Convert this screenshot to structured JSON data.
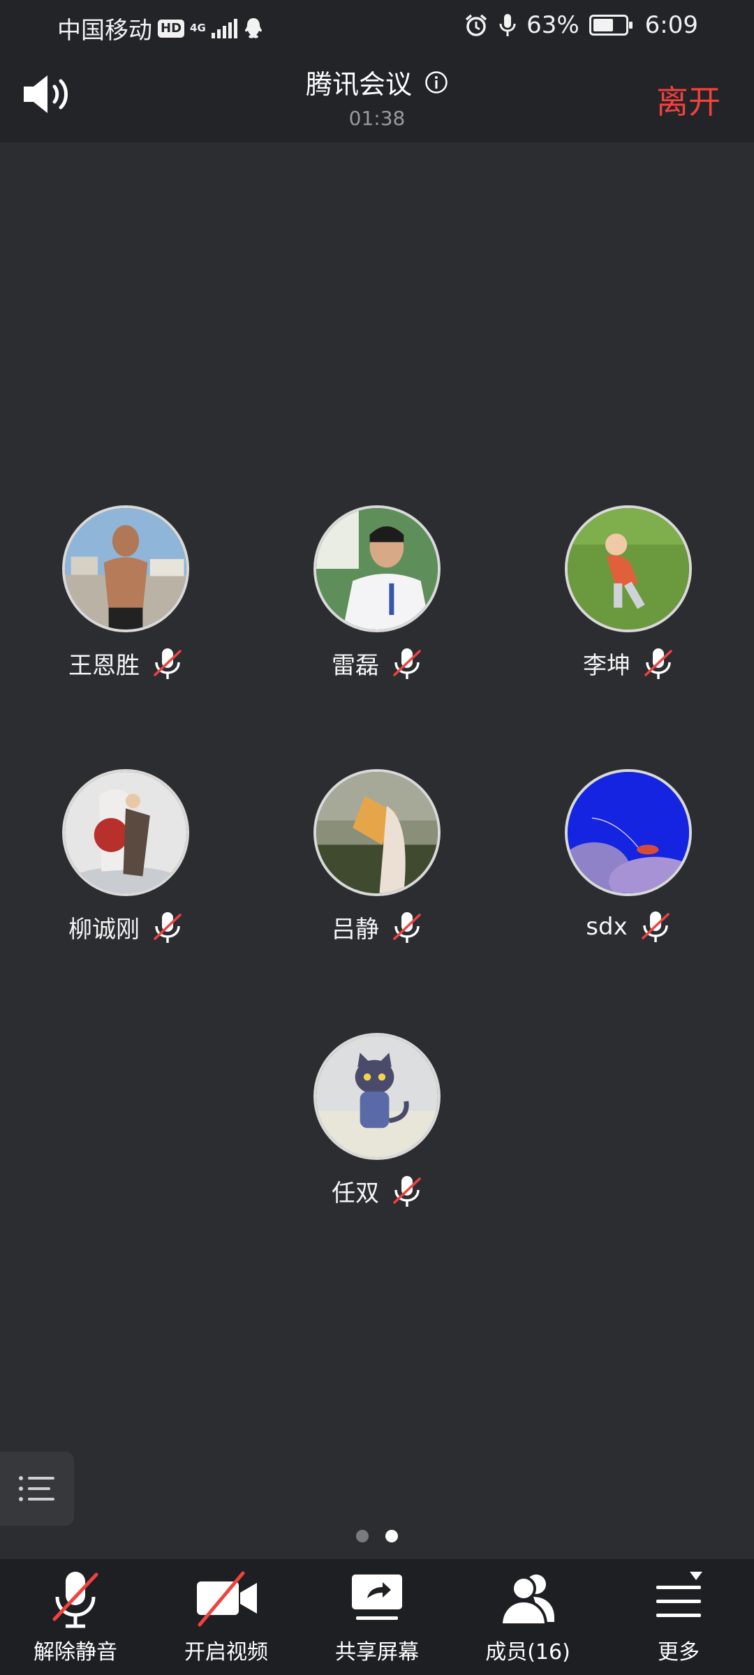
{
  "status_bar": {
    "carrier": "中国移动",
    "hd": "HD",
    "network": "4G",
    "battery": "63%",
    "battery_level": 0.63,
    "time": "6:09"
  },
  "header": {
    "title": "腾讯会议",
    "timer": "01:38",
    "leave_label": "离开"
  },
  "participants": [
    {
      "name": "王恩胜",
      "muted": true
    },
    {
      "name": "雷磊",
      "muted": true
    },
    {
      "name": "李坤",
      "muted": true
    },
    {
      "name": "柳诚刚",
      "muted": true
    },
    {
      "name": "吕静",
      "muted": true
    },
    {
      "name": "sdx",
      "muted": true
    },
    {
      "name": "任双",
      "muted": true
    }
  ],
  "pagination": {
    "total": 2,
    "current": 2
  },
  "toolbar": {
    "unmute_label": "解除静音",
    "video_label": "开启视频",
    "share_label": "共享屏幕",
    "members_label": "成员(16)",
    "more_label": "更多"
  },
  "colors": {
    "background": "#2c2d31",
    "header": "#232428",
    "toolbar": "#1e1f23",
    "leave": "#f0423e",
    "mute_slash": "#f0423e"
  }
}
